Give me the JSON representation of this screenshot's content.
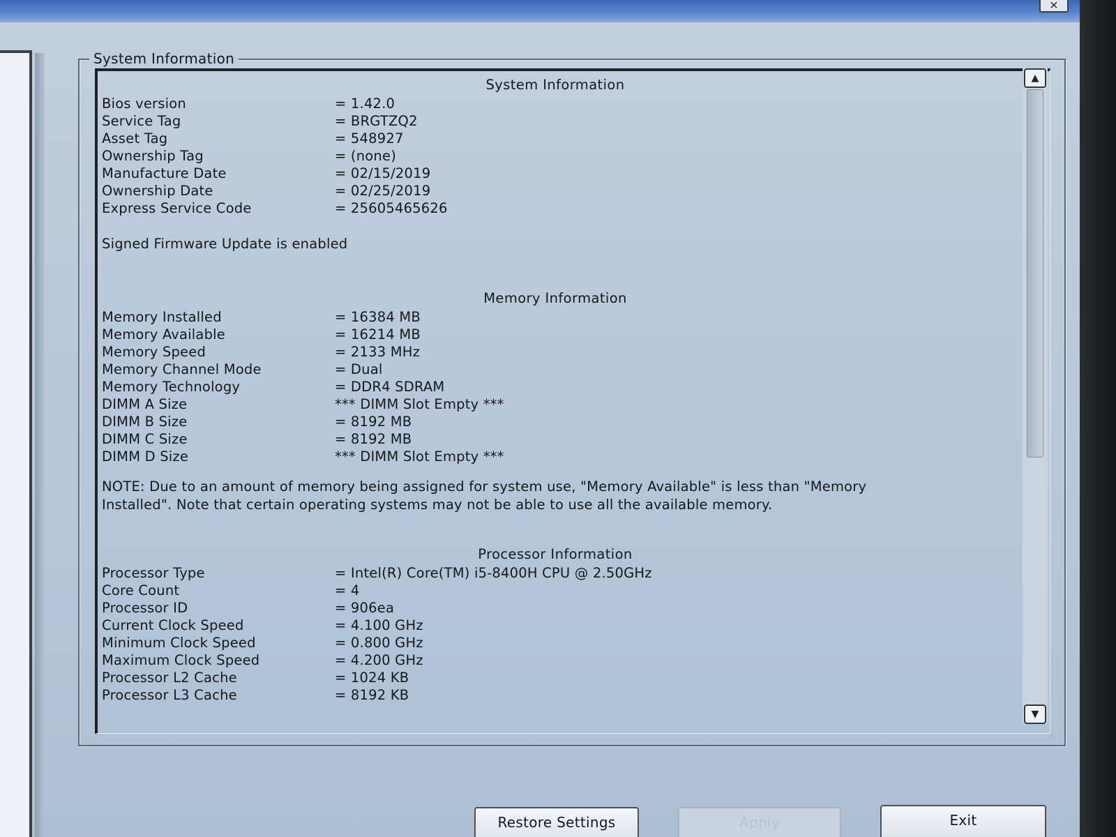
{
  "window": {
    "close_glyph": "✕",
    "group_title": "System Information"
  },
  "system": {
    "title": "System Information",
    "rows": [
      {
        "label": "Bios version",
        "value": "= 1.42.0"
      },
      {
        "label": "Service Tag",
        "value": "= BRGTZQ2"
      },
      {
        "label": "Asset Tag",
        "value": "= 548927"
      },
      {
        "label": "Ownership Tag",
        "value": "= (none)"
      },
      {
        "label": "Manufacture Date",
        "value": "= 02/15/2019"
      },
      {
        "label": "Ownership Date",
        "value": "= 02/25/2019"
      },
      {
        "label": "Express Service Code",
        "value": "= 25605465626"
      }
    ],
    "firmware_status": "Signed Firmware Update is enabled"
  },
  "memory": {
    "title": "Memory Information",
    "rows": [
      {
        "label": "Memory Installed",
        "value": "= 16384 MB"
      },
      {
        "label": "Memory Available",
        "value": "= 16214 MB"
      },
      {
        "label": "Memory Speed",
        "value": "= 2133 MHz"
      },
      {
        "label": "Memory Channel Mode",
        "value": "= Dual"
      },
      {
        "label": "Memory Technology",
        "value": "= DDR4 SDRAM"
      },
      {
        "label": "DIMM A Size",
        "value": "*** DIMM Slot Empty ***"
      },
      {
        "label": "DIMM B Size",
        "value": "= 8192 MB"
      },
      {
        "label": "DIMM C Size",
        "value": "= 8192 MB"
      },
      {
        "label": "DIMM D Size",
        "value": "*** DIMM Slot Empty ***"
      }
    ],
    "note": "NOTE: Due to an amount of memory being assigned for system use, \"Memory Available\" is less than \"Memory Installed\". Note that certain operating systems may not be able to use all the available memory."
  },
  "processor": {
    "title": "Processor Information",
    "rows": [
      {
        "label": "Processor Type",
        "value": "= Intel(R) Core(TM) i5-8400H CPU @ 2.50GHz"
      },
      {
        "label": "Core Count",
        "value": "= 4"
      },
      {
        "label": "Processor ID",
        "value": "= 906ea"
      },
      {
        "label": "Current Clock Speed",
        "value": "= 4.100 GHz"
      },
      {
        "label": "Minimum Clock Speed",
        "value": "= 0.800 GHz"
      },
      {
        "label": "Maximum Clock Speed",
        "value": "= 4.200 GHz"
      },
      {
        "label": "Processor L2 Cache",
        "value": "= 1024 KB"
      },
      {
        "label": "Processor L3 Cache",
        "value": "= 8192 KB"
      }
    ]
  },
  "scrollbar": {
    "up_glyph": "▲",
    "down_glyph": "▼"
  },
  "buttons": {
    "restore": "Restore Settings",
    "apply": "Apply",
    "exit": "Exit"
  }
}
